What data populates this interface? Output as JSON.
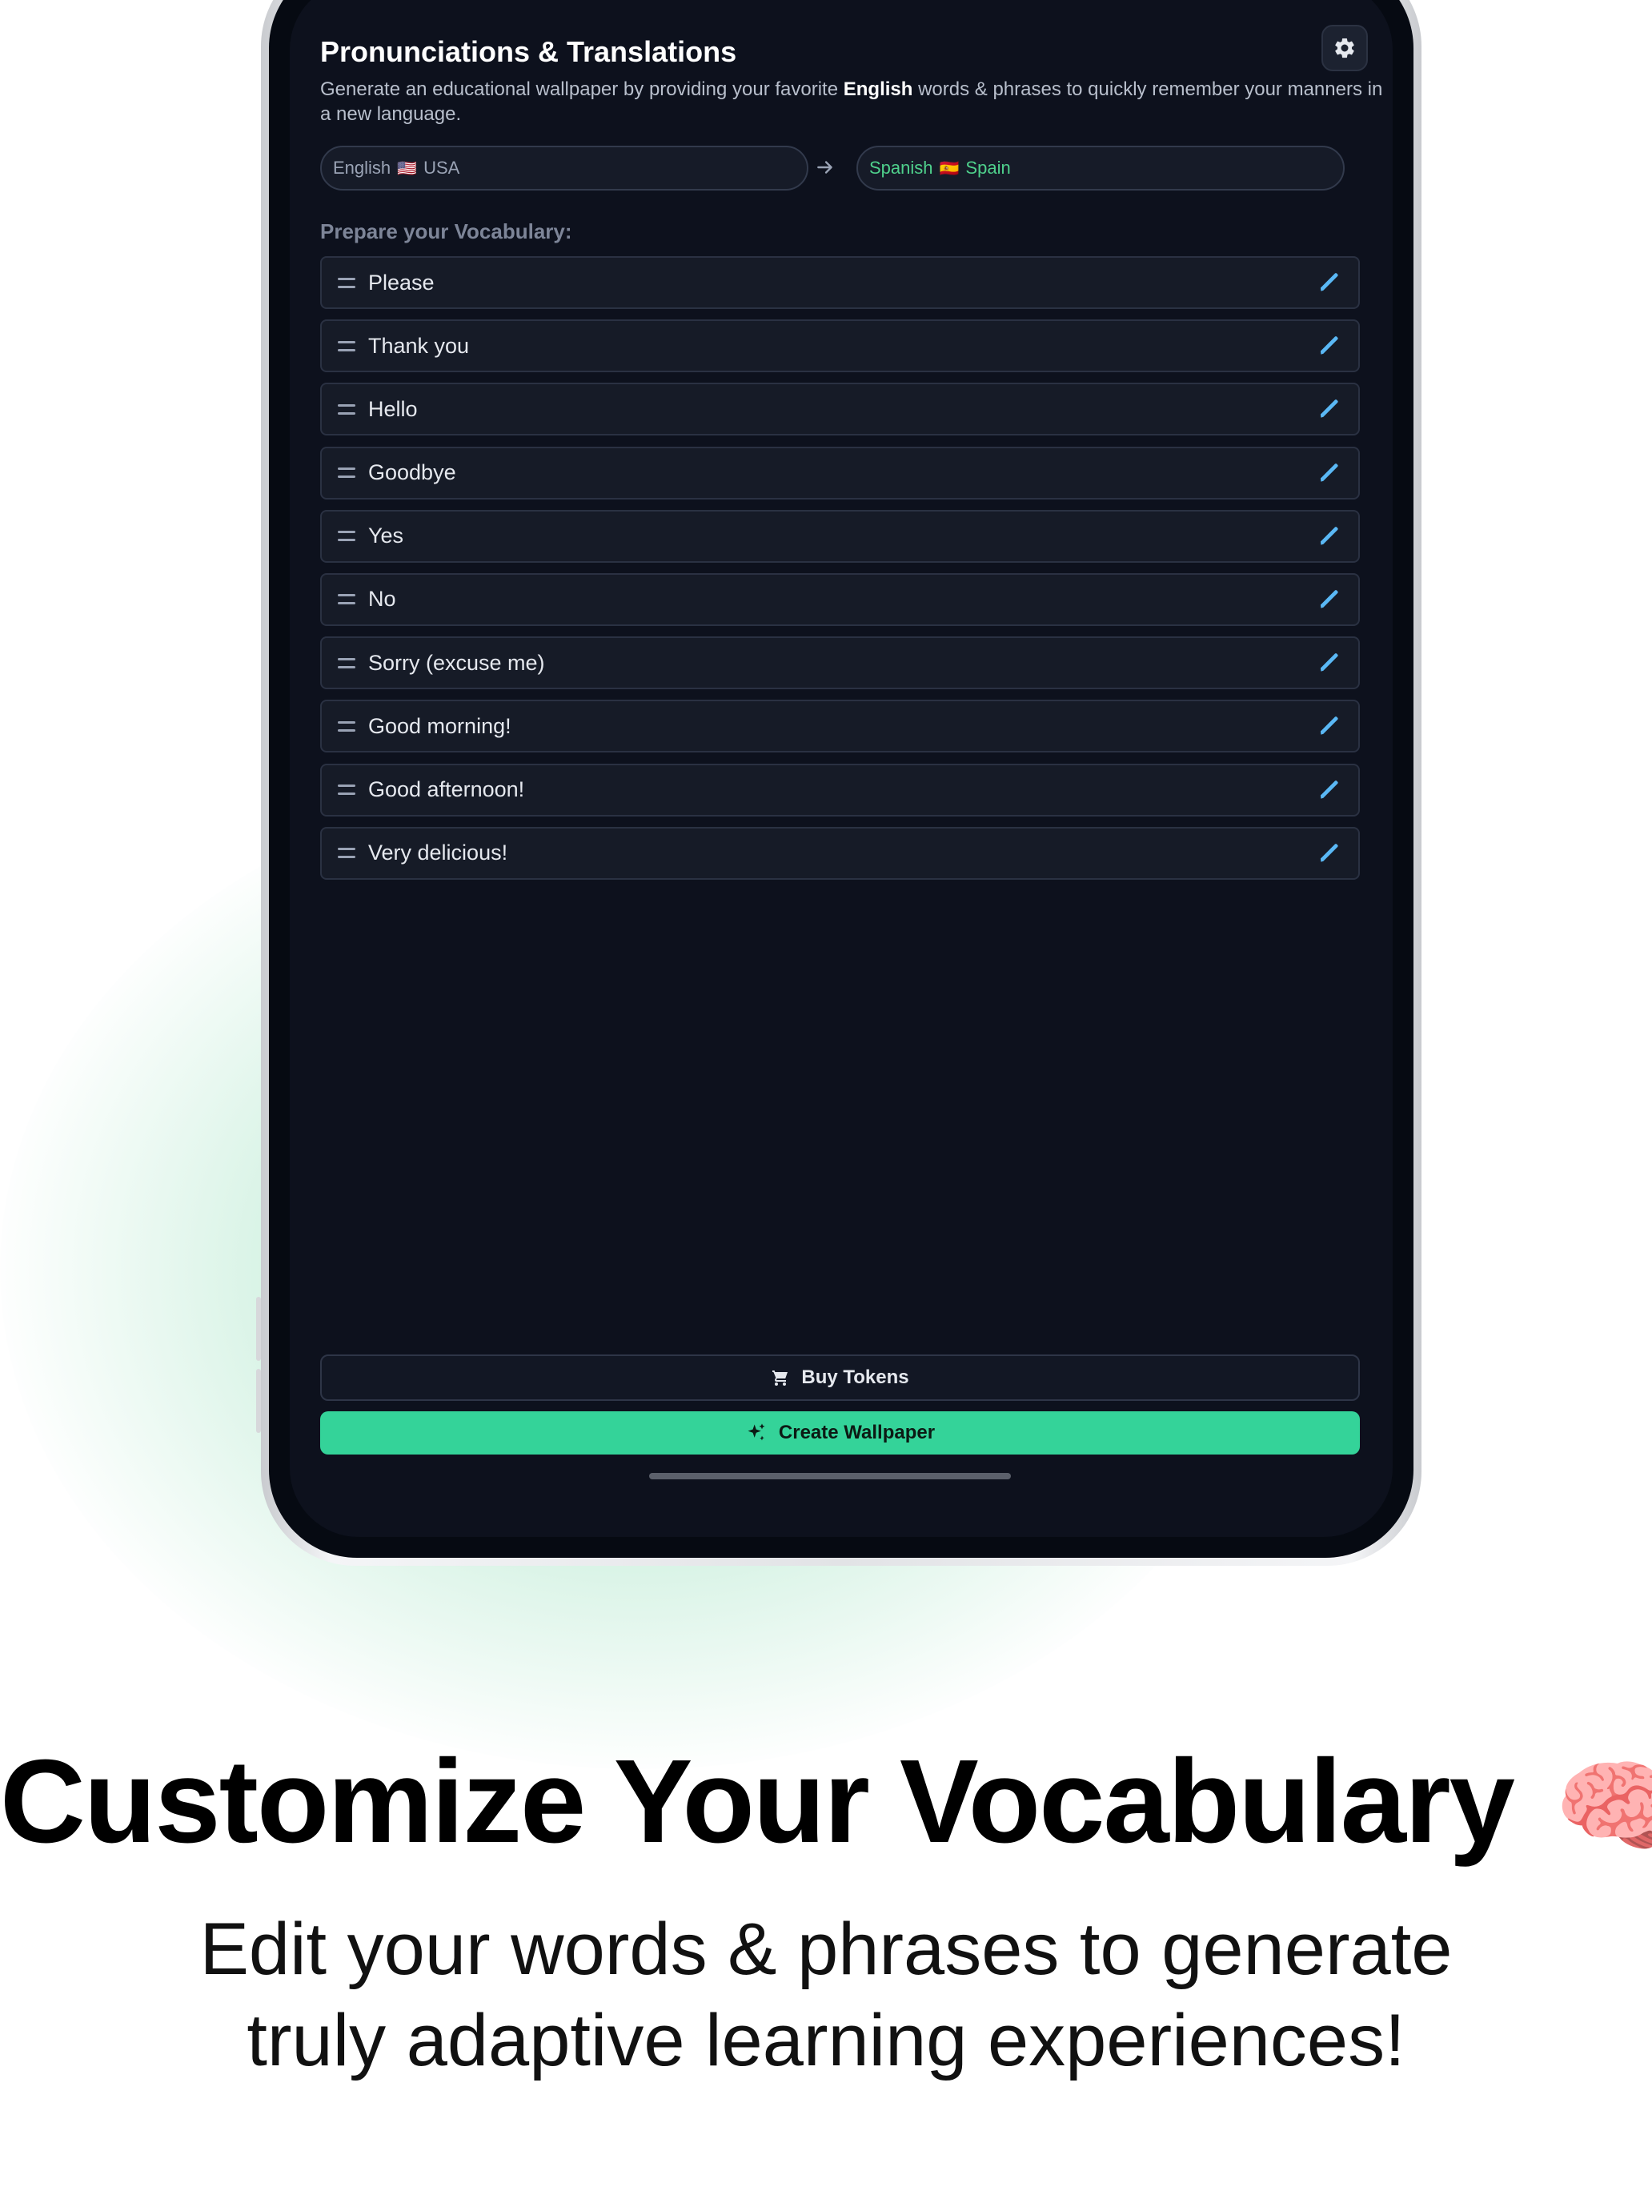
{
  "app": {
    "title": "Pronunciations & Translations",
    "description_prefix": "Generate an educational wallpaper by providing your favorite ",
    "description_bold": "English",
    "description_suffix": " words & phrases to quickly remember your manners in a new language.",
    "settings_icon": "gear-icon"
  },
  "languages": {
    "from_name": "English",
    "from_flag": "🇺🇸",
    "from_region": "USA",
    "to_name": "Spanish",
    "to_flag": "🇪🇸",
    "to_region": "Spain",
    "arrow_icon": "arrow-right-icon"
  },
  "vocabulary": {
    "label": "Prepare your Vocabulary:",
    "items": [
      "Please",
      "Thank you",
      "Hello",
      "Goodbye",
      "Yes",
      "No",
      "Sorry (excuse me)",
      "Good morning!",
      "Good afternoon!",
      "Very delicious!"
    ]
  },
  "actions": {
    "buy_label": "Buy Tokens",
    "buy_icon": "cart-icon",
    "create_label": "Create Wallpaper",
    "create_icon": "sparkles-icon"
  },
  "marketing": {
    "headline": "Customize Your Vocabulary",
    "headline_emoji": "🧠",
    "subline_1": "Edit your words & phrases to generate",
    "subline_2": "truly adaptive learning experiences!"
  },
  "colors": {
    "accent": "#34d399",
    "target_language": "#4fd18c",
    "edit_icon": "#5ab8f5",
    "screen_bg": "#0d111d"
  }
}
